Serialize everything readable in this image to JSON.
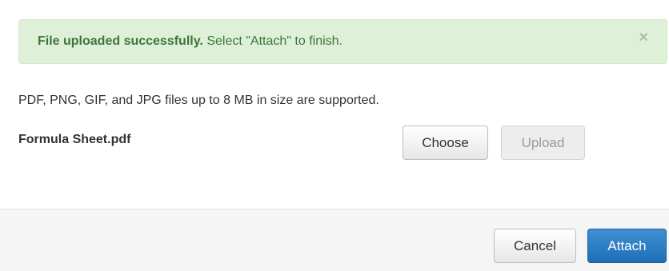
{
  "alert": {
    "strong_text": "File uploaded successfully.",
    "message": " Select \"Attach\" to finish.",
    "close_glyph": "×",
    "color": "#3c763d",
    "background": "#dff0d8"
  },
  "uploader": {
    "support_text": "PDF, PNG, GIF, and JPG files up to 8 MB in size are supported.",
    "file_name": "Formula Sheet.pdf",
    "choose_label": "Choose",
    "upload_label": "Upload"
  },
  "footer": {
    "cancel_label": "Cancel",
    "attach_label": "Attach",
    "attach_color": "#2a7bc4"
  }
}
